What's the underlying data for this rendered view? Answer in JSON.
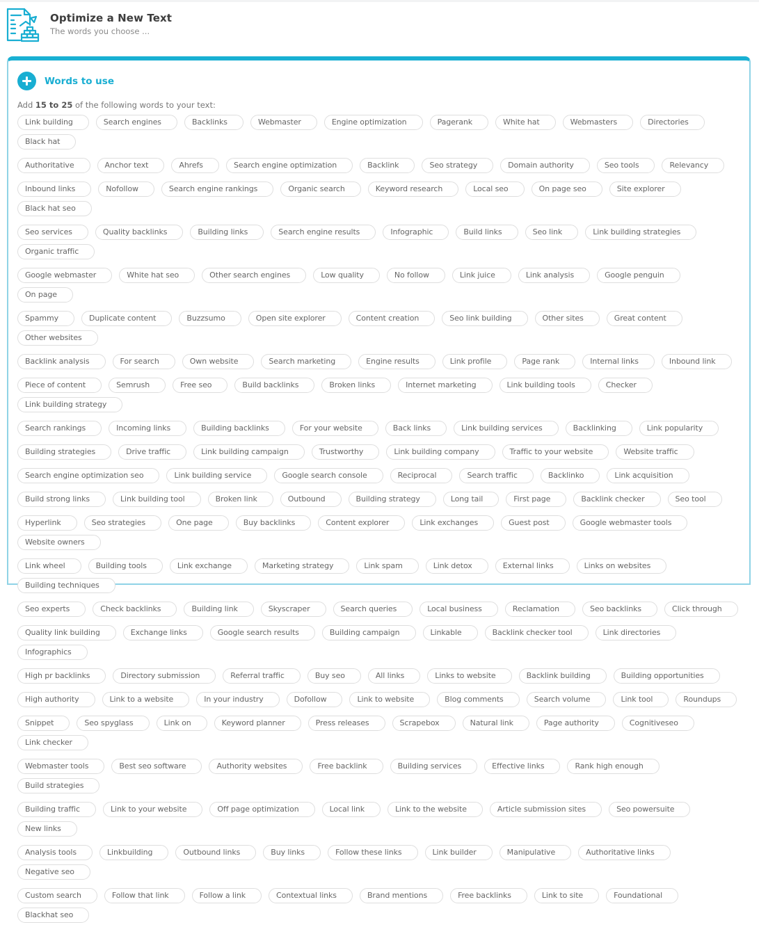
{
  "header": {
    "title": "Optimize a New Text",
    "subtitle": "The words you choose ...",
    "logo_icon": "document-with-bricks-icon"
  },
  "panel": {
    "title": "Words to use",
    "add_icon": "plus-circle-icon",
    "instruction_prefix": "Add ",
    "instruction_range": "15 to 25",
    "instruction_suffix": " of the following words to your text:"
  },
  "colors": {
    "accent": "#19aed2",
    "panel_border": "#8fd3e6",
    "chip_border": "#dedede",
    "title_text": "#3d3d3d"
  },
  "words": [
    "Link building",
    "Search engines",
    "Backlinks",
    "Webmaster",
    "Engine optimization",
    "Pagerank",
    "White hat",
    "Webmasters",
    "Directories",
    "Black hat",
    "Authoritative",
    "Anchor text",
    "Ahrefs",
    "Search engine optimization",
    "Backlink",
    "Seo strategy",
    "Domain authority",
    "Seo tools",
    "Relevancy",
    "Inbound links",
    "Nofollow",
    "Search engine rankings",
    "Organic search",
    "Keyword research",
    "Local seo",
    "On page seo",
    "Site explorer",
    "Black hat seo",
    "Seo services",
    "Quality backlinks",
    "Building links",
    "Search engine results",
    "Infographic",
    "Build links",
    "Seo link",
    "Link building strategies",
    "Organic traffic",
    "Google webmaster",
    "White hat seo",
    "Other search engines",
    "Low quality",
    "No follow",
    "Link juice",
    "Link analysis",
    "Google penguin",
    "On page",
    "Spammy",
    "Duplicate content",
    "Buzzsumo",
    "Open site explorer",
    "Content creation",
    "Seo link building",
    "Other sites",
    "Great content",
    "Other websites",
    "Backlink analysis",
    "For search",
    "Own website",
    "Search marketing",
    "Engine results",
    "Link profile",
    "Page rank",
    "Internal links",
    "Inbound link",
    "Piece of content",
    "Semrush",
    "Free seo",
    "Build backlinks",
    "Broken links",
    "Internet marketing",
    "Link building tools",
    "Checker",
    "Link building strategy",
    "Search rankings",
    "Incoming links",
    "Building backlinks",
    "For your website",
    "Back links",
    "Link building services",
    "Backlinking",
    "Link popularity",
    "Building strategies",
    "Drive traffic",
    "Link building campaign",
    "Trustworthy",
    "Link building company",
    "Traffic to your website",
    "Website traffic",
    "Search engine optimization seo",
    "Link building service",
    "Google search console",
    "Reciprocal",
    "Search traffic",
    "Backlinko",
    "Link acquisition",
    "Build strong links",
    "Link building tool",
    "Broken link",
    "Outbound",
    "Building strategy",
    "Long tail",
    "First page",
    "Backlink checker",
    "Seo tool",
    "Hyperlink",
    "Seo strategies",
    "One page",
    "Buy backlinks",
    "Content explorer",
    "Link exchanges",
    "Guest post",
    "Google webmaster tools",
    "Website owners",
    "Link wheel",
    "Building tools",
    "Link exchange",
    "Marketing strategy",
    "Link spam",
    "Link detox",
    "External links",
    "Links on websites",
    "Building techniques",
    "Seo experts",
    "Check backlinks",
    "Building link",
    "Skyscraper",
    "Search queries",
    "Local business",
    "Reclamation",
    "Seo backlinks",
    "Click through",
    "Quality link building",
    "Exchange links",
    "Google search results",
    "Building campaign",
    "Linkable",
    "Backlink checker tool",
    "Link directories",
    "Infographics",
    "High pr backlinks",
    "Directory submission",
    "Referral traffic",
    "Buy seo",
    "All links",
    "Links to website",
    "Backlink building",
    "Building opportunities",
    "High authority",
    "Link to a website",
    "In your industry",
    "Dofollow",
    "Link to website",
    "Blog comments",
    "Search volume",
    "Link tool",
    "Roundups",
    "Snippet",
    "Seo spyglass",
    "Link on",
    "Keyword planner",
    "Press releases",
    "Scrapebox",
    "Natural link",
    "Page authority",
    "Cognitiveseo",
    "Link checker",
    "Webmaster tools",
    "Best seo software",
    "Authority websites",
    "Free backlink",
    "Building services",
    "Effective links",
    "Rank high enough",
    "Build strategies",
    "Building traffic",
    "Link to your website",
    "Off page optimization",
    "Local link",
    "Link to the website",
    "Article submission sites",
    "Seo powersuite",
    "New links",
    "Analysis tools",
    "Linkbuilding",
    "Outbound links",
    "Buy links",
    "Follow these links",
    "Link builder",
    "Manipulative",
    "Authoritative links",
    "Negative seo",
    "Custom search",
    "Follow that link",
    "Follow a link",
    "Contextual links",
    "Brand mentions",
    "Free backlinks",
    "Link to site",
    "Foundational",
    "Blackhat seo"
  ],
  "rows": [
    10,
    9,
    9,
    9,
    9,
    9,
    9,
    9,
    8,
    7,
    7,
    9,
    9,
    9,
    9,
    8,
    8,
    9,
    10,
    8,
    8,
    9,
    9
  ]
}
